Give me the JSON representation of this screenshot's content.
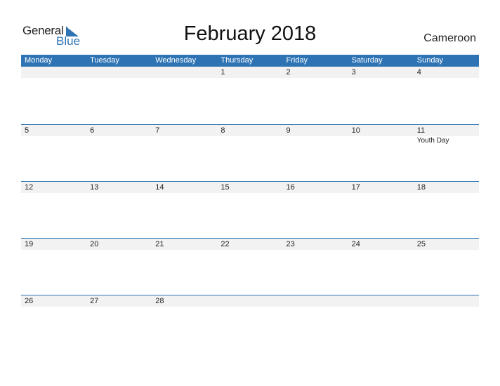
{
  "logo": {
    "line1": "General",
    "line2": "Blue"
  },
  "title": "February 2018",
  "country": "Cameroon",
  "colors": {
    "accent": "#2e74b5",
    "row_bg": "#f2f2f2"
  },
  "weekdays": [
    "Monday",
    "Tuesday",
    "Wednesday",
    "Thursday",
    "Friday",
    "Saturday",
    "Sunday"
  ],
  "weeks": [
    {
      "days": [
        "",
        "",
        "",
        "1",
        "2",
        "3",
        "4"
      ],
      "events": [
        "",
        "",
        "",
        "",
        "",
        "",
        ""
      ]
    },
    {
      "days": [
        "5",
        "6",
        "7",
        "8",
        "9",
        "10",
        "11"
      ],
      "events": [
        "",
        "",
        "",
        "",
        "",
        "",
        "Youth Day"
      ]
    },
    {
      "days": [
        "12",
        "13",
        "14",
        "15",
        "16",
        "17",
        "18"
      ],
      "events": [
        "",
        "",
        "",
        "",
        "",
        "",
        ""
      ]
    },
    {
      "days": [
        "19",
        "20",
        "21",
        "22",
        "23",
        "24",
        "25"
      ],
      "events": [
        "",
        "",
        "",
        "",
        "",
        "",
        ""
      ]
    },
    {
      "days": [
        "26",
        "27",
        "28",
        "",
        "",
        "",
        ""
      ],
      "events": [
        "",
        "",
        "",
        "",
        "",
        "",
        ""
      ]
    }
  ]
}
